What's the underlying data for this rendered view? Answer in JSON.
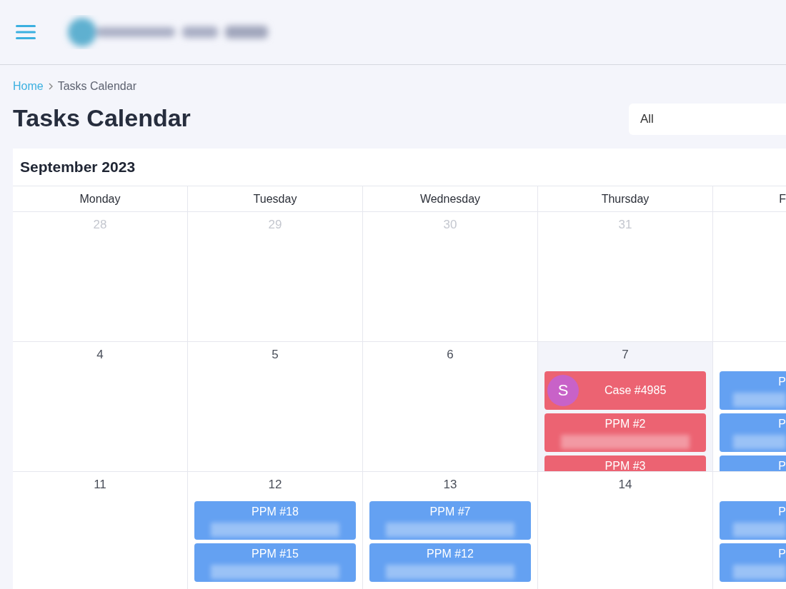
{
  "breadcrumb": [
    {
      "label": "Home",
      "link": true
    },
    {
      "label": "Tasks Calendar",
      "link": false
    }
  ],
  "page_title": "Tasks Calendar",
  "filter": {
    "value": "All"
  },
  "calendar": {
    "month_title": "September 2023",
    "weekdays": [
      "Monday",
      "Tuesday",
      "Wednesday",
      "Thursday",
      "F"
    ],
    "weeks": [
      {
        "days": [
          {
            "number": "28",
            "muted": true,
            "today": false
          },
          {
            "number": "29",
            "muted": true,
            "today": false
          },
          {
            "number": "30",
            "muted": true,
            "today": false
          },
          {
            "number": "31",
            "muted": true,
            "today": false
          },
          {
            "today": false
          }
        ]
      },
      {
        "days": [
          {
            "number": "4",
            "muted": false,
            "today": false
          },
          {
            "number": "5",
            "muted": false,
            "today": false
          },
          {
            "number": "6",
            "muted": false,
            "today": false
          },
          {
            "number": "7",
            "muted": false,
            "today": true,
            "events": [
              {
                "kind": "case",
                "label": "Case #4985",
                "avatar": "S",
                "color": "#ec6372"
              },
              {
                "kind": "task",
                "label": "PPM #2",
                "color": "#ec6372"
              },
              {
                "kind": "task",
                "label": "PPM #3",
                "color": "#ec6372"
              }
            ]
          },
          {
            "today": false,
            "events": [
              {
                "kind": "task",
                "label": "P",
                "color": "#64a1f2"
              },
              {
                "kind": "task",
                "label": "P",
                "color": "#64a1f2"
              },
              {
                "kind": "task",
                "label": "P",
                "color": "#64a1f2"
              }
            ]
          }
        ]
      },
      {
        "days": [
          {
            "number": "11",
            "muted": false,
            "today": false
          },
          {
            "number": "12",
            "muted": false,
            "today": false,
            "events": [
              {
                "kind": "task",
                "label": "PPM #18",
                "color": "#64a1f2"
              },
              {
                "kind": "task",
                "label": "PPM #15",
                "color": "#64a1f2"
              }
            ]
          },
          {
            "number": "13",
            "muted": false,
            "today": false,
            "events": [
              {
                "kind": "task",
                "label": "PPM #7",
                "color": "#64a1f2"
              },
              {
                "kind": "task",
                "label": "PPM #12",
                "color": "#64a1f2"
              }
            ]
          },
          {
            "number": "14",
            "muted": false,
            "today": false
          },
          {
            "today": false,
            "events": [
              {
                "kind": "task",
                "label": "P",
                "color": "#64a1f2"
              },
              {
                "kind": "task",
                "label": "P",
                "color": "#64a1f2"
              }
            ]
          }
        ]
      }
    ]
  }
}
